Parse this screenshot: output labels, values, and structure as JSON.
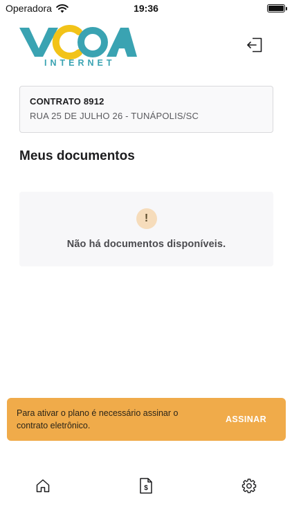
{
  "status_bar": {
    "carrier": "Operadora",
    "time": "19:36"
  },
  "header": {
    "logo_icon": "vcoa-internet-logo",
    "logo_text": "VCOA",
    "logo_subtext": "INTERNET",
    "logout_icon": "logout-icon"
  },
  "contract": {
    "title": "CONTRATO 8912",
    "address": "RUA 25 DE JULHO 26 - TUNÁPOLIS/SC"
  },
  "documents": {
    "section_title": "Meus documentos",
    "empty_icon": "exclamation-icon",
    "empty_message": "Não há documentos disponíveis."
  },
  "banner": {
    "message": "Para ativar o plano é necessário assinar o contrato eletrônico.",
    "action_label": "ASSINAR"
  },
  "bottom_nav": {
    "items": [
      {
        "icon": "home-icon"
      },
      {
        "icon": "invoice-icon"
      },
      {
        "icon": "settings-icon"
      }
    ]
  },
  "colors": {
    "brand_teal": "#3aa3b2",
    "brand_yellow": "#f2c318",
    "banner_orange": "#f0ab4a",
    "warning_circle": "#f6dcbb"
  }
}
